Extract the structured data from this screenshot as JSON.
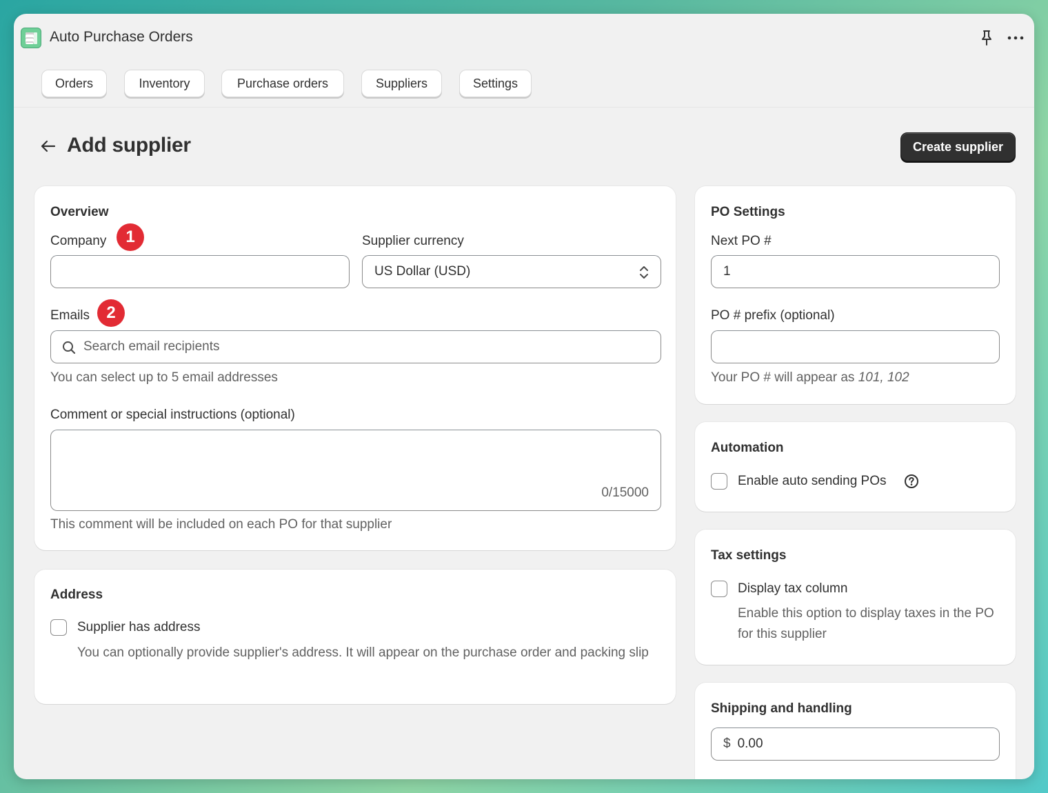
{
  "app": {
    "title": "Auto Purchase Orders"
  },
  "nav": {
    "tabs": [
      {
        "label": "Orders"
      },
      {
        "label": "Inventory"
      },
      {
        "label": "Purchase orders"
      },
      {
        "label": "Suppliers"
      },
      {
        "label": "Settings"
      }
    ]
  },
  "page": {
    "title": "Add supplier",
    "primary_action": "Create supplier"
  },
  "overview": {
    "title": "Overview",
    "company_label": "Company",
    "company_badge": "1",
    "company_value": "",
    "currency_label": "Supplier currency",
    "currency_value": "US Dollar (USD)",
    "emails_label": "Emails",
    "emails_badge": "2",
    "emails_placeholder": "Search email recipients",
    "emails_help": "You can select up to 5 email addresses",
    "comment_label": "Comment or special instructions (optional)",
    "comment_counter": "0/15000",
    "comment_help": "This comment will be included on each PO for that supplier"
  },
  "address": {
    "title": "Address",
    "checkbox_label": "Supplier has address",
    "help": "You can optionally provide supplier's address. It will appear on the purchase order and packing slip"
  },
  "po_settings": {
    "title": "PO Settings",
    "next_po_label": "Next PO #",
    "next_po_value": "1",
    "prefix_label": "PO # prefix (optional)",
    "prefix_value": "",
    "help_prefix": "Your PO # will appear as ",
    "help_example": "101, 102"
  },
  "automation": {
    "title": "Automation",
    "checkbox_label": "Enable auto sending POs"
  },
  "tax": {
    "title": "Tax settings",
    "checkbox_label": "Display tax column",
    "help": "Enable this option to display taxes in the PO for this supplier"
  },
  "shipping": {
    "title": "Shipping and handling",
    "currency_symbol": "$",
    "value": "0.00"
  },
  "icons": {
    "app": "purchase-orders-app-icon",
    "pin": "pin-icon",
    "more": "more-horizontal-icon",
    "back": "arrow-left-icon",
    "search": "search-icon",
    "select": "chevron-up-down-icon",
    "help": "question-circle-icon"
  },
  "colors": {
    "primary_button": "#303030",
    "badge": "#e22b34",
    "background": "#f1f1f1"
  }
}
